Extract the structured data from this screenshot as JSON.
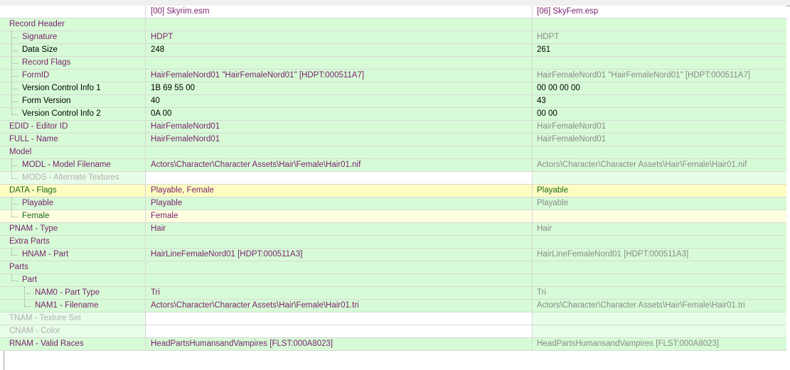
{
  "columns": [
    "",
    "[00] Skyrim.esm",
    "[06] SkyFem.esp"
  ],
  "rows": [
    {
      "name": "Record Header",
      "indent": 0,
      "tree": "",
      "v1": "",
      "v2": "",
      "bg": "green",
      "bg1": "green",
      "bg2": "green",
      "nc": "purple",
      "c1": "black",
      "c2": "black"
    },
    {
      "name": "Signature",
      "indent": 1,
      "tree": "mid",
      "v1": "HDPT",
      "v2": "HDPT",
      "bg": "green",
      "bg1": "green",
      "bg2": "green",
      "nc": "purple",
      "c1": "purple",
      "c2": "gray"
    },
    {
      "name": "Data Size",
      "indent": 1,
      "tree": "mid",
      "v1": "248",
      "v2": "261",
      "bg": "green",
      "bg1": "green",
      "bg2": "green",
      "nc": "black",
      "c1": "black",
      "c2": "black"
    },
    {
      "name": "Record Flags",
      "indent": 1,
      "tree": "mid",
      "v1": "",
      "v2": "",
      "bg": "green",
      "bg1": "green",
      "bg2": "green",
      "nc": "purple",
      "c1": "black",
      "c2": "black"
    },
    {
      "name": "FormID",
      "indent": 1,
      "tree": "mid",
      "v1": "HairFemaleNord01 \"HairFemaleNord01\" [HDPT:000511A7]",
      "v2": "HairFemaleNord01 \"HairFemaleNord01\" [HDPT:000511A7]",
      "bg": "green",
      "bg1": "green",
      "bg2": "green",
      "nc": "purple",
      "c1": "purple",
      "c2": "gray"
    },
    {
      "name": "Version Control Info 1",
      "indent": 1,
      "tree": "mid",
      "v1": "1B 69 55 00",
      "v2": "00 00 00 00",
      "bg": "green",
      "bg1": "green",
      "bg2": "green",
      "nc": "black",
      "c1": "black",
      "c2": "black"
    },
    {
      "name": "Form Version",
      "indent": 1,
      "tree": "mid",
      "v1": "40",
      "v2": "43",
      "bg": "green",
      "bg1": "green",
      "bg2": "green",
      "nc": "black",
      "c1": "black",
      "c2": "black"
    },
    {
      "name": "Version Control Info 2",
      "indent": 1,
      "tree": "last",
      "v1": "0A 00",
      "v2": "00 00",
      "bg": "green",
      "bg1": "green",
      "bg2": "green",
      "nc": "black",
      "c1": "black",
      "c2": "black"
    },
    {
      "name": "EDID - Editor ID",
      "indent": 0,
      "tree": "",
      "v1": "HairFemaleNord01",
      "v2": "HairFemaleNord01",
      "bg": "green",
      "bg1": "green",
      "bg2": "green",
      "nc": "purple",
      "c1": "purple",
      "c2": "gray"
    },
    {
      "name": "FULL - Name",
      "indent": 0,
      "tree": "",
      "v1": "HairFemaleNord01",
      "v2": "HairFemaleNord01",
      "bg": "green",
      "bg1": "green",
      "bg2": "green",
      "nc": "purple",
      "c1": "purple",
      "c2": "gray"
    },
    {
      "name": "Model",
      "indent": 0,
      "tree": "",
      "v1": "",
      "v2": "",
      "bg": "green",
      "bg1": "green",
      "bg2": "green",
      "nc": "purple",
      "c1": "black",
      "c2": "black"
    },
    {
      "name": "MODL - Model Filename",
      "indent": 1,
      "tree": "mid",
      "v1": "Actors\\Character\\Character Assets\\Hair\\Female\\Hair01.nif",
      "v2": "Actors\\Character\\Character Assets\\Hair\\Female\\Hair01.nif",
      "bg": "green",
      "bg1": "green",
      "bg2": "green",
      "nc": "purple",
      "c1": "purple",
      "c2": "gray"
    },
    {
      "name": "MODS - Alternate Textures",
      "indent": 1,
      "tree": "last",
      "v1": "",
      "v2": "",
      "bg": "lgreen",
      "bg1": "white",
      "bg2": "lgreen",
      "nc": "lgray",
      "c1": "black",
      "c2": "black"
    },
    {
      "name": "DATA - Flags",
      "indent": 0,
      "tree": "",
      "v1": "Playable, Female",
      "v2": "Playable",
      "bg": "yellow",
      "bg1": "yellow",
      "bg2": "yellow",
      "nc": "green",
      "c1": "purple",
      "c2": "green"
    },
    {
      "name": "Playable",
      "indent": 1,
      "tree": "mid",
      "v1": "Playable",
      "v2": "Playable",
      "bg": "green",
      "bg1": "green",
      "bg2": "green",
      "nc": "purple",
      "c1": "purple",
      "c2": "gray"
    },
    {
      "name": "Female",
      "indent": 1,
      "tree": "last",
      "v1": "Female",
      "v2": "",
      "bg": "lyellow",
      "bg1": "lyellow",
      "bg2": "lyellow",
      "nc": "green",
      "c1": "purple",
      "c2": "black"
    },
    {
      "name": "PNAM - Type",
      "indent": 0,
      "tree": "",
      "v1": "Hair",
      "v2": "Hair",
      "bg": "green",
      "bg1": "green",
      "bg2": "green",
      "nc": "purple",
      "c1": "purple",
      "c2": "gray"
    },
    {
      "name": "Extra Parts",
      "indent": 0,
      "tree": "",
      "v1": "",
      "v2": "",
      "bg": "green",
      "bg1": "green",
      "bg2": "green",
      "nc": "purple",
      "c1": "black",
      "c2": "black"
    },
    {
      "name": "HNAM - Part",
      "indent": 1,
      "tree": "last",
      "v1": "HairLineFemaleNord01 [HDPT:000511A3]",
      "v2": "HairLineFemaleNord01 [HDPT:000511A3]",
      "bg": "green",
      "bg1": "green",
      "bg2": "green",
      "nc": "purple",
      "c1": "purple",
      "c2": "gray"
    },
    {
      "name": "Parts",
      "indent": 0,
      "tree": "",
      "v1": "",
      "v2": "",
      "bg": "green",
      "bg1": "green",
      "bg2": "green",
      "nc": "purple",
      "c1": "black",
      "c2": "black"
    },
    {
      "name": "Part",
      "indent": 1,
      "tree": "last",
      "v1": "",
      "v2": "",
      "bg": "green",
      "bg1": "green",
      "bg2": "green",
      "nc": "purple",
      "c1": "black",
      "c2": "black"
    },
    {
      "name": "NAM0 - Part Type",
      "indent": 2,
      "tree": "mid2",
      "v1": "Tri",
      "v2": "Tri",
      "bg": "green",
      "bg1": "green",
      "bg2": "green",
      "nc": "purple",
      "c1": "purple",
      "c2": "gray"
    },
    {
      "name": "NAM1 - Filename",
      "indent": 2,
      "tree": "last2",
      "v1": "Actors\\Character\\Character Assets\\Hair\\Female\\Hair01.tri",
      "v2": "Actors\\Character\\Character Assets\\Hair\\Female\\Hair01.tri",
      "bg": "green",
      "bg1": "green",
      "bg2": "green",
      "nc": "purple",
      "c1": "purple",
      "c2": "gray"
    },
    {
      "name": "TNAM - Texture Set",
      "indent": 0,
      "tree": "",
      "v1": "",
      "v2": "",
      "bg": "lgreen",
      "bg1": "white",
      "bg2": "lgreen",
      "nc": "lgray",
      "c1": "black",
      "c2": "black"
    },
    {
      "name": "CNAM - Color",
      "indent": 0,
      "tree": "",
      "v1": "",
      "v2": "",
      "bg": "lgreen",
      "bg1": "white",
      "bg2": "lgreen",
      "nc": "lgray",
      "c1": "black",
      "c2": "black"
    },
    {
      "name": "RNAM - Valid Races",
      "indent": 0,
      "tree": "",
      "v1": "HeadPartsHumansandVampires [FLST:000A8023]",
      "v2": "HeadPartsHumansandVampires [FLST:000A8023]",
      "bg": "green",
      "bg1": "green",
      "bg2": "green",
      "nc": "purple",
      "c1": "purple",
      "c2": "gray"
    }
  ]
}
